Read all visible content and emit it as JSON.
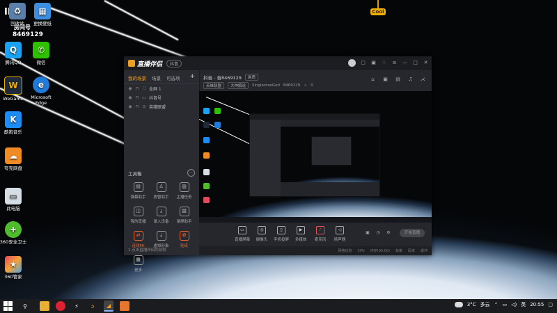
{
  "desktop": {
    "overlay_top": "IE6",
    "overlay_tag": "房间号",
    "overlay_id": "8469129",
    "sticker": "Cool",
    "icons": [
      {
        "label": "回收站",
        "icon": "recycle-bin-icon",
        "color": "#5a7fa8"
      },
      {
        "label": "更换壁纸",
        "icon": "wallpaper-icon",
        "color": "#3c8ee0"
      },
      {
        "label": "腾讯QQ",
        "icon": "qq-icon",
        "color": "#1aa3f5"
      },
      {
        "label": "微信",
        "icon": "wechat-icon",
        "color": "#2dc100"
      },
      {
        "label": "WeGame",
        "icon": "wegame-icon",
        "color": "#1e2a3a"
      },
      {
        "label": "Microsoft Edge",
        "icon": "edge-icon",
        "color": "#1f7ad8"
      },
      {
        "label": "酷狗音乐",
        "icon": "kugou-icon",
        "color": "#1d8cf4"
      },
      {
        "label": "夸克网盘",
        "icon": "disk-icon",
        "color": "#f08a24"
      },
      {
        "label": "此电脑",
        "icon": "computer-icon",
        "color": "#d7dde5"
      },
      {
        "label": "360安全卫士",
        "icon": "security-icon",
        "color": "#4fbd2b"
      },
      {
        "label": "360管家",
        "icon": "manager-icon",
        "color": "#e4485a"
      }
    ]
  },
  "app": {
    "title": "直播伴侣",
    "version_badge": "抖音",
    "scene_tabs": [
      "我的场景",
      "场景",
      "可选项"
    ],
    "scenes": [
      "全屏 1",
      "抖音号",
      "英雄联盟"
    ],
    "toolbox_title": "工具箱",
    "tools": [
      "弹幕助手",
      "房管助手",
      "主播任务",
      "我的直播",
      "录入设备",
      "录屏助手",
      "连线PK",
      "虚拟形象",
      "贴纸",
      "更多"
    ],
    "footer": "1.点击直播伴侣的前帧",
    "head": {
      "name": "抖音 - 音8469129",
      "chip": "画质",
      "tag1": "英雄联盟",
      "tag2": "大神解说",
      "user": "SingleroseGod",
      "id": "8469129",
      "hot": "0"
    },
    "controls": [
      "直播屏幕",
      "摄像头",
      "手机投屏",
      "多媒体",
      "麦克风",
      "扬声器"
    ],
    "go_live": "开始直播",
    "status": [
      "网络状态",
      "CPU",
      "内存(00:00)",
      "帧率",
      "码率",
      "缓冲"
    ]
  },
  "taskbar": {
    "temp": "3°C",
    "weather": "多云",
    "ime": "英",
    "time": "20:55",
    "apps": [
      "file-explorer-icon",
      "browser-icon",
      "media-icon",
      "ai-icon",
      "douyin-companion-icon",
      "app-icon"
    ]
  }
}
